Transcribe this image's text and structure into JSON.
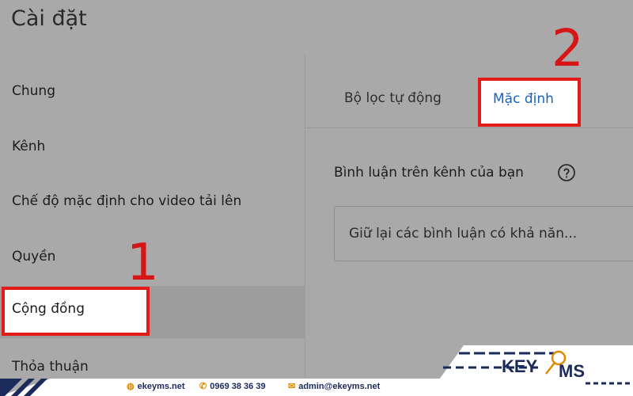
{
  "header": {
    "title": "Cài đặt"
  },
  "sidebar": {
    "items": [
      {
        "label": "Chung"
      },
      {
        "label": "Kênh"
      },
      {
        "label": "Chế độ mặc định cho video tải lên"
      },
      {
        "label": "Quyền"
      },
      {
        "label": "Cộng đồng"
      },
      {
        "label": "Thỏa thuận"
      }
    ],
    "active_index": 4
  },
  "tabs": [
    {
      "label": "Bộ lọc tự động"
    },
    {
      "label": "Mặc định"
    }
  ],
  "main": {
    "section_title": "Bình luận trên kênh của bạn",
    "dropdown_value": "Giữ lại các bình luận có khả năn..."
  },
  "annotations": {
    "step1": "1",
    "step2": "2"
  },
  "footer": {
    "website": "ekeyms.net",
    "phone": "0969 38 36 39",
    "email": "admin@ekeyms.net"
  },
  "logo": {
    "text_left": "KEY",
    "text_right": "MS"
  },
  "colors": {
    "accent": "#1565c0",
    "highlight": "#e21a1a",
    "overlay": "#a9a9a9",
    "footer_brand": "#1a2a5a"
  }
}
